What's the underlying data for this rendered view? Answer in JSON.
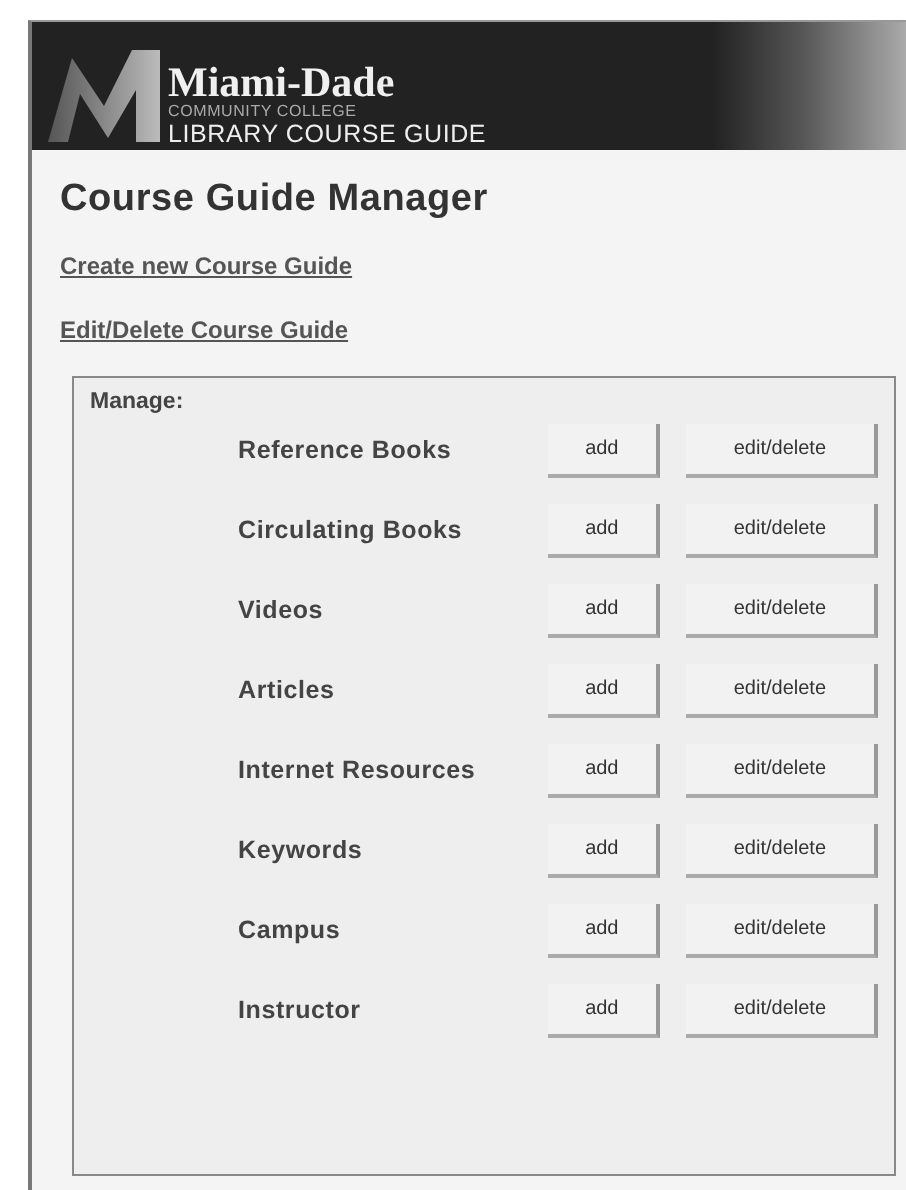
{
  "header": {
    "name": "Miami-Dade",
    "subtitle": "COMMUNITY COLLEGE",
    "title": "LIBRARY COURSE GUIDE"
  },
  "heading": "Course Guide Manager",
  "links": [
    "Create new Course Guide",
    "Edit/Delete Course Guide"
  ],
  "manage": {
    "label": "Manage:",
    "rows": [
      {
        "name": "Reference Books",
        "buttons": [
          "add",
          "edit/delete"
        ]
      },
      {
        "name": "Circulating Books",
        "buttons": [
          "add",
          "edit/delete"
        ]
      },
      {
        "name": "Videos",
        "buttons": [
          "add",
          "edit/delete"
        ]
      },
      {
        "name": "Articles",
        "buttons": [
          "add",
          "edit/delete"
        ]
      },
      {
        "name": "Internet Resources",
        "buttons": [
          "add",
          "edit/delete"
        ]
      },
      {
        "name": "Keywords",
        "buttons": [
          "add",
          "edit/delete"
        ]
      },
      {
        "name": "Campus",
        "buttons": [
          "add",
          "edit/delete"
        ]
      },
      {
        "name": "Instructor",
        "buttons": [
          "add",
          "edit/delete"
        ]
      }
    ]
  }
}
